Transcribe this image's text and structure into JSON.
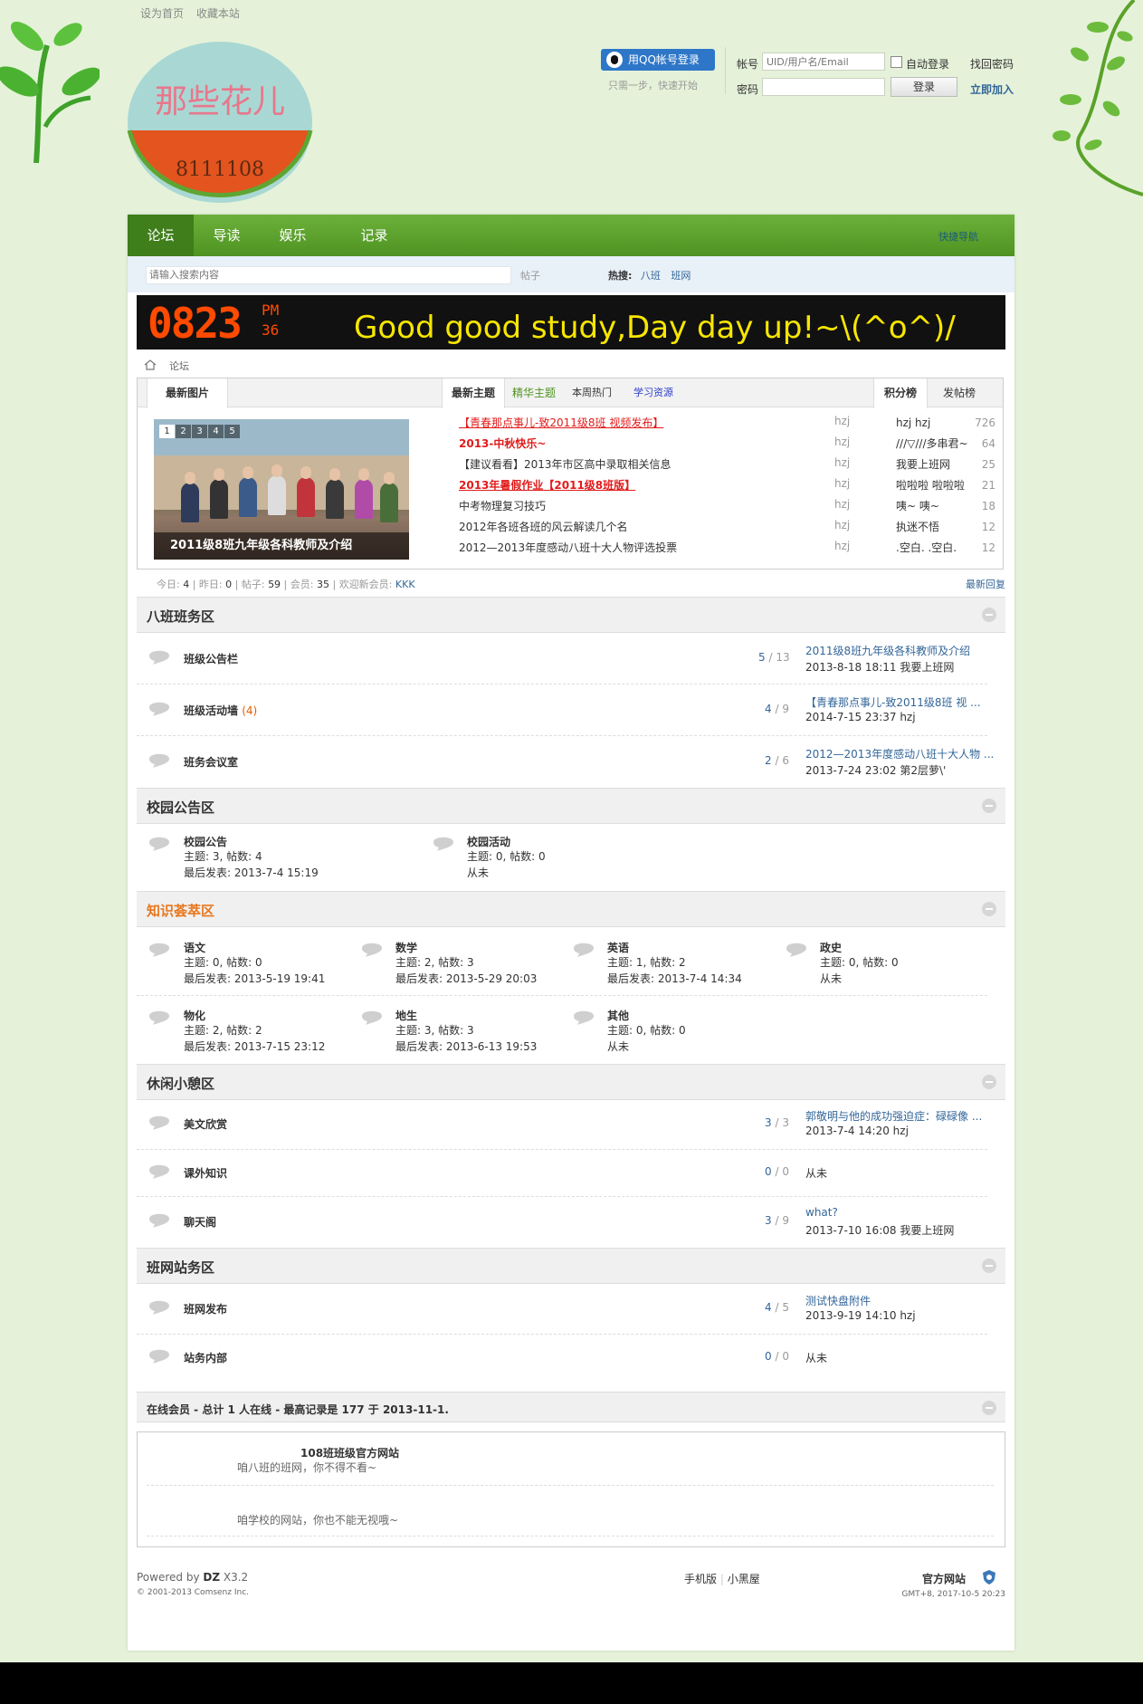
{
  "topbar": {
    "set_home": "设为首页",
    "bookmark": "收藏本站"
  },
  "logo": {
    "text": "那些花儿",
    "sub": "8111108"
  },
  "login": {
    "qq_button": "用QQ帐号登录",
    "qq_sub": "只需一步，快速开始",
    "account_label": "帐号",
    "account_placeholder": "UID/用户名/Email",
    "auto_login": "自动登录",
    "find_password": "找回密码",
    "password_label": "密码",
    "login_button": "登录",
    "register": "立即加入"
  },
  "nav": {
    "items": [
      "论坛",
      "导读",
      "娱乐",
      "记录"
    ],
    "quick": "快捷导航"
  },
  "search": {
    "placeholder": "请输入搜索内容",
    "type": "帖子",
    "hot_label": "热搜:",
    "hot": [
      "八班",
      "班网"
    ]
  },
  "banner": {
    "clock": "0823",
    "ampm": "PM",
    "seconds": "36",
    "text": "Good good study,Day day up!~\\(^o^)/"
  },
  "breadcrumb": "论坛",
  "portal": {
    "tabs": {
      "pics": "最新图片",
      "newest": "最新主题",
      "digest": "精华主题",
      "hot": "本周热门",
      "study": "学习资源",
      "credits": "积分榜",
      "posts": "发帖榜"
    },
    "photo_caption": "2011级8班九年级各科教师及介绍",
    "photo_nums": [
      "1",
      "2",
      "3",
      "4",
      "5"
    ],
    "threads": [
      {
        "title": "【青春那点事儿-致2011级8班 视频发布】",
        "author": "hzj",
        "style": "red"
      },
      {
        "title": "2013-中秋快乐~",
        "author": "hzj",
        "style": "red"
      },
      {
        "title": "【建议看看】2013年市区高中录取相关信息",
        "author": "hzj",
        "style": "normal"
      },
      {
        "title": "2013年暑假作业【2011级8班版】",
        "author": "hzj",
        "style": "red"
      },
      {
        "title": "中考物理复习技巧",
        "author": "hzj",
        "style": "normal"
      },
      {
        "title": "2012年各班各班的风云解读几个名",
        "author": "hzj",
        "style": "normal"
      },
      {
        "title": "2012—2013年度感动八班十大人物评选投票",
        "author": "hzj",
        "style": "normal"
      }
    ],
    "ranks": [
      {
        "name": "hzj hzj",
        "value": "726"
      },
      {
        "name": "///▽///多串君~",
        "value": "64"
      },
      {
        "name": "我要上班网",
        "value": "25"
      },
      {
        "name": "啦啦啦 啦啦啦",
        "value": "21"
      },
      {
        "name": "咦~ 咦~",
        "value": "18"
      },
      {
        "name": "执迷不悟",
        "value": "12"
      },
      {
        "name": ".空白. .空白.",
        "value": "12"
      }
    ]
  },
  "stats": {
    "today_label": "今日:",
    "today": "4",
    "yesterday_label": "昨日:",
    "yesterday": "0",
    "posts_label": "帖子:",
    "posts": "59",
    "members_label": "会员:",
    "members": "35",
    "welcome_label": "欢迎新会员:",
    "newest_member": "KKK",
    "latest_reply": "最新回复"
  },
  "categories": {
    "c1": {
      "title": "八班班务区",
      "forums": [
        {
          "name": "班级公告栏",
          "today": "",
          "threads": "5",
          "posts": "13",
          "last_title": "2011级8班九年级各科教师及介绍",
          "last_meta": "2013-8-18 18:11 我要上班网"
        },
        {
          "name": "班级活动墙",
          "today": "(4)",
          "threads": "4",
          "posts": "9",
          "last_title": "【青春那点事儿-致2011级8班 视 ...",
          "last_meta": "2014-7-15 23:37 hzj"
        },
        {
          "name": "班务会议室",
          "today": "",
          "threads": "2",
          "posts": "6",
          "last_title": "2012—2013年度感动八班十大人物 ...",
          "last_meta": "2013-7-24 23:02 第2层萝\\'"
        }
      ]
    },
    "c2": {
      "title": "校园公告区",
      "forums": [
        {
          "name": "校园公告",
          "line1": "主题: 3, 帖数: 4",
          "line2": "最后发表: 2013-7-4 15:19"
        },
        {
          "name": "校园活动",
          "line1": "主题: 0, 帖数: 0",
          "line2": "从未"
        }
      ]
    },
    "c3": {
      "title": "知识荟萃区",
      "forums": [
        {
          "name": "语文",
          "line1": "主题: 0, 帖数: 0",
          "line2": "最后发表: 2013-5-19 19:41"
        },
        {
          "name": "数学",
          "line1": "主题: 2, 帖数: 3",
          "line2": "最后发表: 2013-5-29 20:03"
        },
        {
          "name": "英语",
          "line1": "主题: 1, 帖数: 2",
          "line2": "最后发表: 2013-7-4 14:34"
        },
        {
          "name": "政史",
          "line1": "主题: 0, 帖数: 0",
          "line2": "从未"
        },
        {
          "name": "物化",
          "line1": "主题: 2, 帖数: 2",
          "line2": "最后发表: 2013-7-15 23:12"
        },
        {
          "name": "地生",
          "line1": "主题: 3, 帖数: 3",
          "line2": "最后发表: 2013-6-13 19:53"
        },
        {
          "name": "其他",
          "line1": "主题: 0, 帖数: 0",
          "line2": "从未"
        }
      ]
    },
    "c4": {
      "title": "休闲小憩区",
      "forums": [
        {
          "name": "美文欣赏",
          "threads": "3",
          "posts": "3",
          "last_title": "郭敬明与他的成功强迫症：碌碌像 ...",
          "last_meta": "2013-7-4 14:20 hzj"
        },
        {
          "name": "课外知识",
          "threads": "0",
          "posts": "0",
          "last_title": "",
          "last_meta": "从未"
        },
        {
          "name": "聊天阁",
          "threads": "3",
          "posts": "9",
          "last_title": "what?",
          "last_meta": "2013-7-10 16:08 我要上班网"
        }
      ]
    },
    "c5": {
      "title": "班网站务区",
      "forums": [
        {
          "name": "班网发布",
          "threads": "4",
          "posts": "5",
          "last_title": "测试快盘附件",
          "last_meta": "2013-9-19 14:10 hzj"
        },
        {
          "name": "站务内部",
          "threads": "0",
          "posts": "0",
          "last_title": "",
          "last_meta": "从未"
        }
      ]
    }
  },
  "online": "在线会员 - 总计 1 人在线 - 最高记录是 177 于 2013-11-1.",
  "links": {
    "title": "108班班级官方网站",
    "desc1": "咱八班的班网，你不得不看~",
    "desc2": "咱学校的网站，你也不能无视哦~"
  },
  "footer": {
    "powered": "Powered by",
    "brand": "DZ",
    "version": "X3.2",
    "copyright": "© 2001-2013 Comsenz Inc.",
    "mobile": "手机版",
    "blackroom": "小黑屋",
    "official": "官方网站",
    "time": "GMT+8, 2017-10-5 20:23"
  },
  "colors": {
    "nav_green": "#5aa22a",
    "link_blue": "#336699",
    "red_thread": "#e11b1b",
    "orange_cat": "#e8771e",
    "page_bg": "#e5f2d9"
  }
}
